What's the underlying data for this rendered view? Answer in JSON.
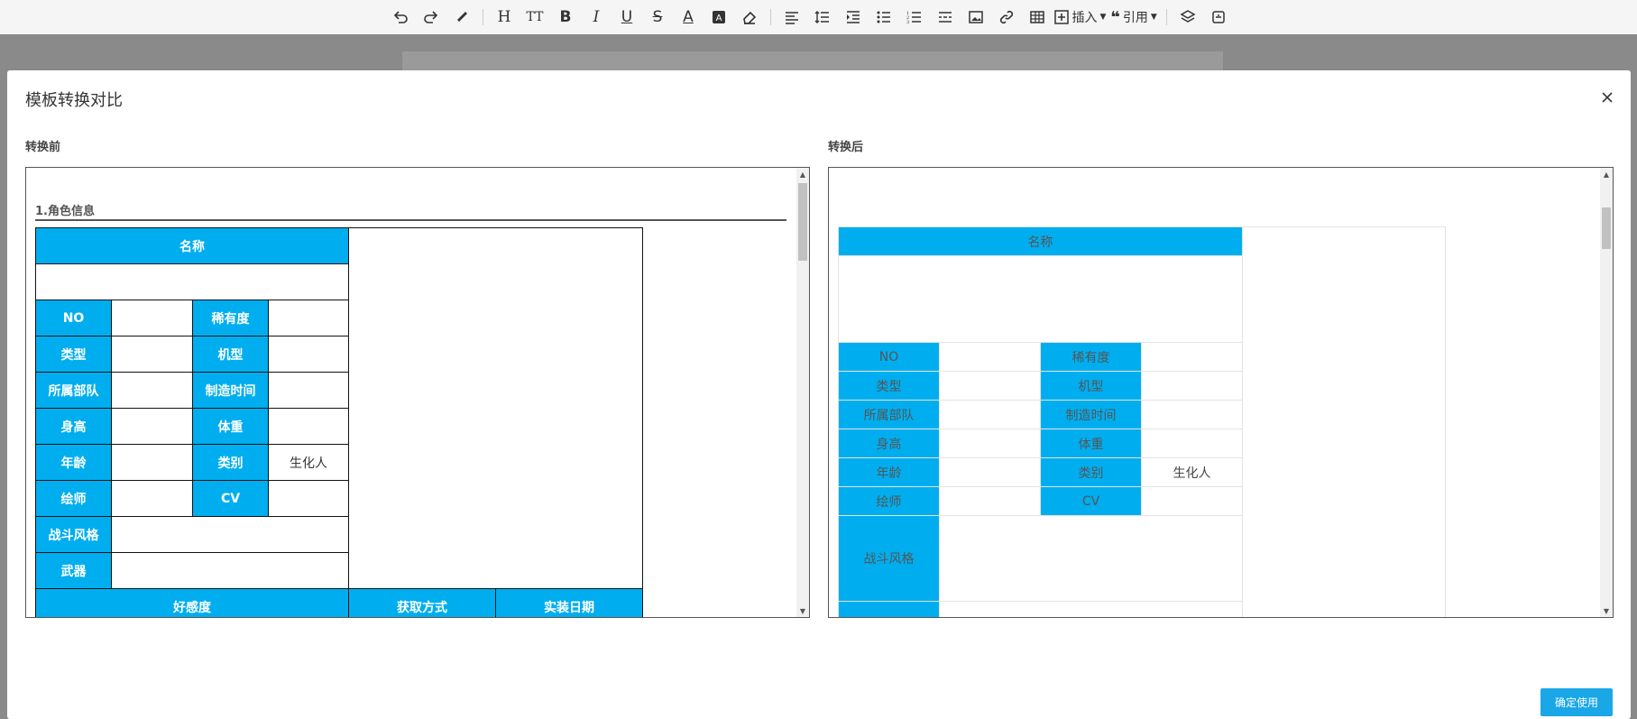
{
  "toolbar": {
    "insert_label": "插入",
    "quote_label": "引用"
  },
  "modal": {
    "title": "模板转换对比",
    "confirm_label": "确定使用"
  },
  "before": {
    "label": "转换前",
    "section_title": "1.角色信息",
    "name_header": "名称",
    "rows": [
      [
        "NO",
        "",
        "稀有度",
        ""
      ],
      [
        "类型",
        "",
        "机型",
        ""
      ],
      [
        "所属部队",
        "",
        "制造时间",
        ""
      ],
      [
        "身高",
        "",
        "体重",
        ""
      ],
      [
        "年龄",
        "",
        "类别",
        "生化人"
      ],
      [
        "绘师",
        "",
        "CV",
        ""
      ]
    ],
    "combat_style": "战斗风格",
    "weapon": "武器",
    "favor": "好感度",
    "obtain": "获取方式",
    "release_date": "实装日期"
  },
  "after": {
    "label": "转换后",
    "name_header": "名称",
    "rows": [
      [
        "NO",
        "",
        "稀有度",
        ""
      ],
      [
        "类型",
        "",
        "机型",
        ""
      ],
      [
        "所属部队",
        "",
        "制造时间",
        ""
      ],
      [
        "身高",
        "",
        "体重",
        ""
      ],
      [
        "年龄",
        "",
        "类别",
        "生化人"
      ],
      [
        "绘师",
        "",
        "CV",
        ""
      ]
    ],
    "combat_style": "战斗风格"
  }
}
